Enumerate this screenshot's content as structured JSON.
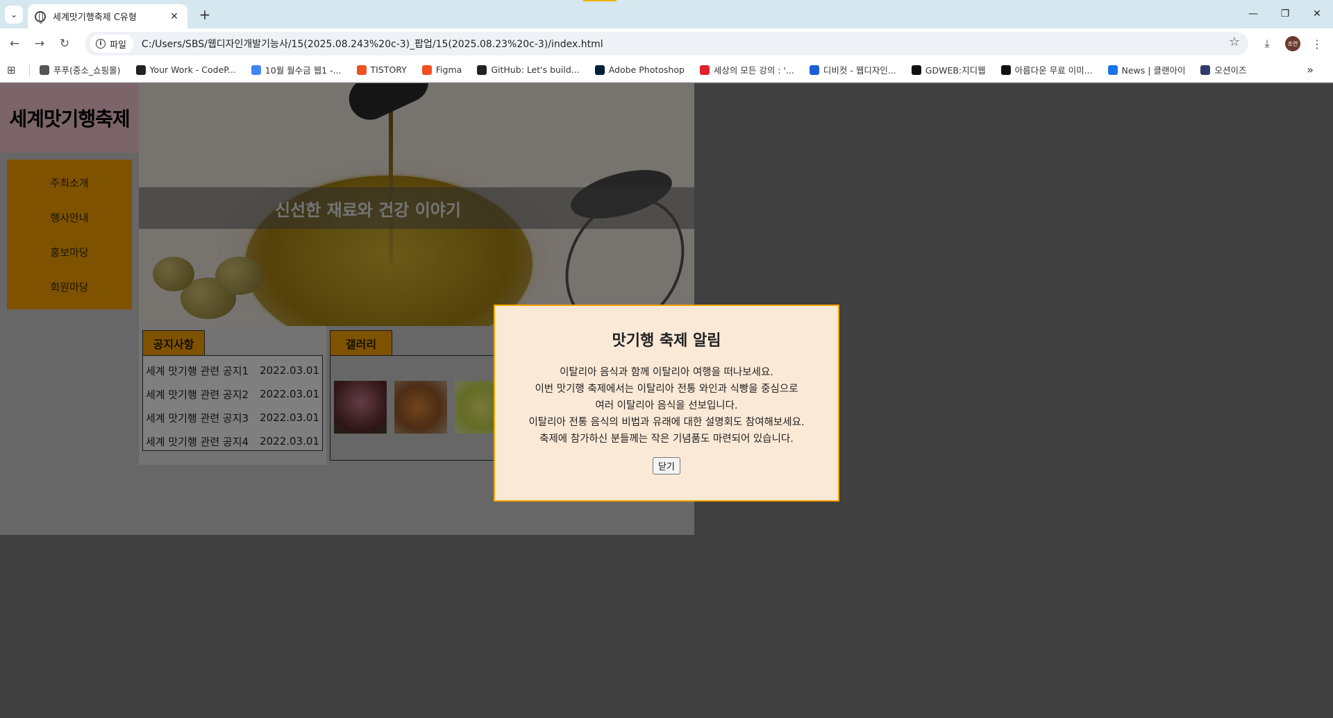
{
  "browser": {
    "tab_title": "세계맛기행축제 C유형",
    "site_chip": "파일",
    "url": "C:/Users/SBS/웹디자인개발기능사/15(2025.08.243%20c-3)_팝업/15(2025.08.23%20c-3)/index.html",
    "avatar_text": "조연",
    "bookmarks": [
      {
        "label": "푸푸(중소_쇼핑몰)",
        "icon": "folder-icon",
        "color": "#555555"
      },
      {
        "label": "Your Work - CodeP...",
        "icon": "codepen-icon",
        "color": "#222222"
      },
      {
        "label": "10월 월수금 웹1 -...",
        "icon": "docs-icon",
        "color": "#4285f4"
      },
      {
        "label": "TISTORY",
        "icon": "tistory-icon",
        "color": "#eb531f"
      },
      {
        "label": "Figma",
        "icon": "figma-icon",
        "color": "#f24e1e"
      },
      {
        "label": "GitHub: Let's build...",
        "icon": "github-icon",
        "color": "#222222"
      },
      {
        "label": "Adobe Photoshop",
        "icon": "photoshop-icon",
        "color": "#001e36"
      },
      {
        "label": "세상의 모든 강의 : '...",
        "icon": "play-icon",
        "color": "#e0202a"
      },
      {
        "label": "디비컷 - 웹디자인...",
        "icon": "dbcut-icon",
        "color": "#1a5fd6"
      },
      {
        "label": "GDWEB:지디웹",
        "icon": "gdweb-icon",
        "color": "#111111"
      },
      {
        "label": "아름다운 무료 이미...",
        "icon": "unsplash-icon",
        "color": "#111111"
      },
      {
        "label": "News | 클랜아이",
        "icon": "news-icon",
        "color": "#1a73e8"
      },
      {
        "label": "오션이즈",
        "icon": "oceanis-icon",
        "color": "#333a6e"
      }
    ]
  },
  "site": {
    "logo": "세계맛기행축제",
    "menu": [
      "주최소개",
      "행사안내",
      "홍보마당",
      "회원마당"
    ],
    "hero_caption": "신선한 재료와 건강 이야기",
    "notice": {
      "tab": "공지사항",
      "items": [
        {
          "title": "세계 맛기행 관련 공지1",
          "date": "2022.03.01"
        },
        {
          "title": "세계 맛기행 관련 공지2",
          "date": "2022.03.01"
        },
        {
          "title": "세계 맛기행 관련 공지3",
          "date": "2022.03.01"
        },
        {
          "title": "세계 맛기행 관련 공지4",
          "date": "2022.03.01"
        }
      ]
    },
    "gallery": {
      "tab": "갤러리"
    }
  },
  "modal": {
    "title": "맛기행 축제 알림",
    "lines": [
      "이탈리아 음식과 함께 이탈리아 여행을 떠나보세요.",
      "이번 맛기행 축제에서는 이탈리아 전통 와인과 식빵을 중심으로",
      "여러 이탈리아 음식을 선보입니다.",
      "이탈리아 전통 음식의 비법과 유래에 대한 설명회도 참여해보세요.",
      "축제에 참가하신 분들께는 작은 기념품도 마련되어 있습니다."
    ],
    "close_label": "닫기"
  },
  "colors": {
    "accent": "#ffa400",
    "logo_bg": "#f9c8d7",
    "modal_bg": "#fbe9d7"
  }
}
